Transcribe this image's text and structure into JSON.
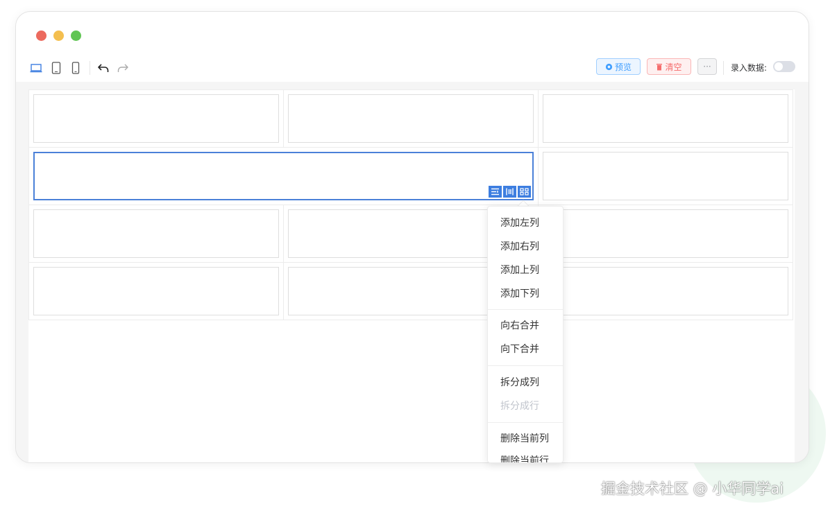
{
  "toolbar": {
    "device_icons": [
      "laptop-icon",
      "tablet-icon",
      "phone-icon"
    ],
    "undo_icon": "undo-icon",
    "redo_icon": "redo-icon",
    "preview_label": "预览",
    "clear_label": "清空",
    "more_label": "···",
    "toggle_label": "录入数据:",
    "toggle_on": false
  },
  "colors": {
    "primary": "#409eff",
    "danger": "#f56c6c",
    "selection": "#4a80d8"
  },
  "grid": {
    "rows": 4,
    "cols": 3,
    "selected_cell": "row 2, columns 1-2 merged"
  },
  "context_menu": {
    "groups": [
      [
        {
          "label": "添加左列",
          "disabled": false
        },
        {
          "label": "添加右列",
          "disabled": false
        },
        {
          "label": "添加上列",
          "disabled": false
        },
        {
          "label": "添加下列",
          "disabled": false
        }
      ],
      [
        {
          "label": "向右合并",
          "disabled": false
        },
        {
          "label": "向下合并",
          "disabled": false
        }
      ],
      [
        {
          "label": "拆分成列",
          "disabled": false
        },
        {
          "label": "拆分成行",
          "disabled": true
        }
      ],
      [
        {
          "label": "删除当前列",
          "disabled": false
        },
        {
          "label": "删除当前行",
          "disabled": false
        }
      ]
    ]
  },
  "watermark": "掘金技术社区 @ 小华同学ai"
}
